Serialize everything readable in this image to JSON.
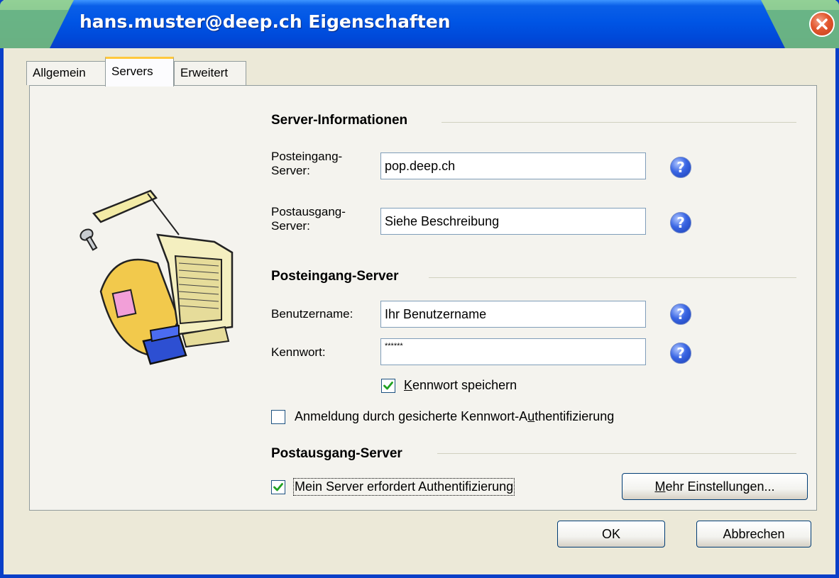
{
  "window": {
    "title": "hans.muster@deep.ch Eigenschaften"
  },
  "tabs": [
    {
      "label": "Allgemein",
      "active": false
    },
    {
      "label": "Servers",
      "active": true
    },
    {
      "label": "Erweitert",
      "active": false
    }
  ],
  "server_info": {
    "heading": "Server-Informationen",
    "incoming_label_line1": "Posteingang-",
    "incoming_label_line2": "Server:",
    "incoming_value": "pop.deep.ch",
    "outgoing_label_line1": "Postausgang-",
    "outgoing_label_line2": "Server:",
    "outgoing_value": "Siehe Beschreibung"
  },
  "incoming_server": {
    "heading": "Posteingang-Server",
    "username_label": "Benutzername:",
    "username_value": "Ihr Benutzername",
    "password_label": "Kennwort:",
    "password_value": "******",
    "save_password_label_prefix": "",
    "save_password_label_mnemonic": "K",
    "save_password_label_rest": "ennwort speichern",
    "save_password_checked": true,
    "spa_label_prefix": "Anmeldung durch gesicherte Kennwort-A",
    "spa_label_mnemonic": "u",
    "spa_label_rest": "thentifizierung",
    "spa_checked": false
  },
  "outgoing_server": {
    "heading": "Postausgang-Server",
    "auth_label": "Mein Server erfordert Authentifizierung",
    "auth_checked": true,
    "more_settings_mnemonic": "M",
    "more_settings_rest": "ehr Einstellungen..."
  },
  "footer": {
    "ok_label": "OK",
    "cancel_label": "Abbrechen"
  },
  "help_glyph": "?",
  "colors": {
    "titlebar": "#0055E5",
    "dialog_bg": "#ECE9D8",
    "panel_bg": "#F4F3EE",
    "tab_highlight": "#FFC83C",
    "help_icon": "#3A66E4",
    "close_button": "#E2562D"
  }
}
